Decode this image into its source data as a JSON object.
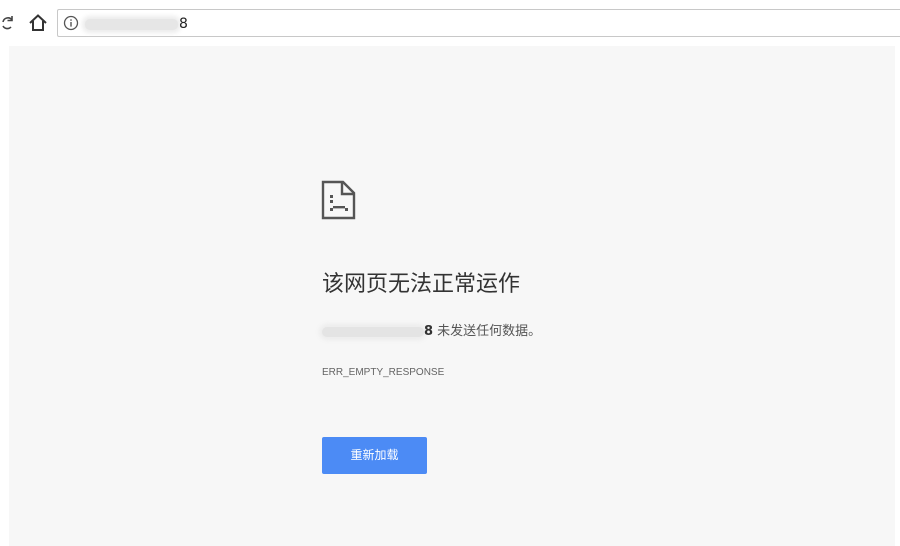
{
  "browser": {
    "url_suffix": "8",
    "icons": {
      "reload": "reload-icon",
      "home": "home-icon",
      "info": "info-icon"
    }
  },
  "error_page": {
    "icon": "sad-page-icon",
    "title": "该网页无法正常运作",
    "host_suffix": "8",
    "description": " 未发送任何数据。",
    "error_code": "ERR_EMPTY_RESPONSE",
    "reload_label": "重新加载"
  },
  "colors": {
    "page_background": "#f7f7f7",
    "button_background": "#4c8bf5",
    "button_text": "#ffffff"
  }
}
